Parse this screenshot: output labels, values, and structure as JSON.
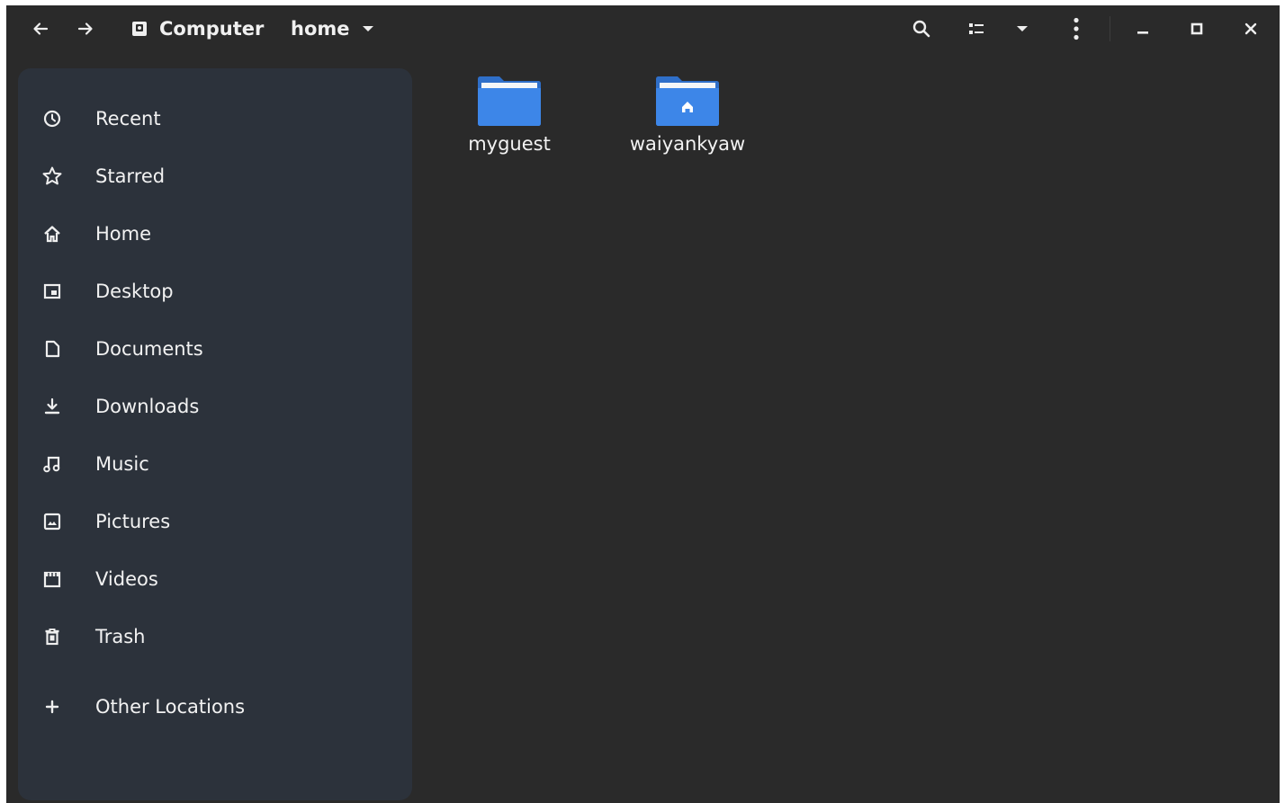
{
  "headerbar": {
    "back_icon": "arrow-left-icon",
    "forward_icon": "arrow-right-icon",
    "breadcrumb": [
      {
        "label": "Computer",
        "icon": "drive-icon"
      },
      {
        "label": "home",
        "icon": "chevron-down-icon"
      }
    ],
    "search_icon": "search-icon",
    "view_icon": "list-view-icon",
    "view_menu_icon": "chevron-down-icon",
    "menu_icon": "kebab-menu-icon",
    "window_controls": [
      "minimize-icon",
      "maximize-icon",
      "close-icon"
    ]
  },
  "sidebar": {
    "items": [
      {
        "label": "Recent",
        "icon": "clock-icon"
      },
      {
        "label": "Starred",
        "icon": "star-icon"
      },
      {
        "label": "Home",
        "icon": "home-icon"
      },
      {
        "label": "Desktop",
        "icon": "desktop-icon"
      },
      {
        "label": "Documents",
        "icon": "document-icon"
      },
      {
        "label": "Downloads",
        "icon": "download-icon"
      },
      {
        "label": "Music",
        "icon": "music-icon"
      },
      {
        "label": "Pictures",
        "icon": "picture-icon"
      },
      {
        "label": "Videos",
        "icon": "video-icon"
      },
      {
        "label": "Trash",
        "icon": "trash-icon"
      },
      {
        "label": "Other Locations",
        "icon": "plus-icon"
      }
    ]
  },
  "files": [
    {
      "name": "myguest",
      "icon": "folder-icon"
    },
    {
      "name": "waiyankyaw",
      "icon": "home-folder-icon"
    }
  ],
  "colors": {
    "window_bg": "#2a2a2a",
    "sidebar_bg": "#2c323b",
    "folder_blue": "#3d86e8",
    "text": "#f2f2f2"
  }
}
